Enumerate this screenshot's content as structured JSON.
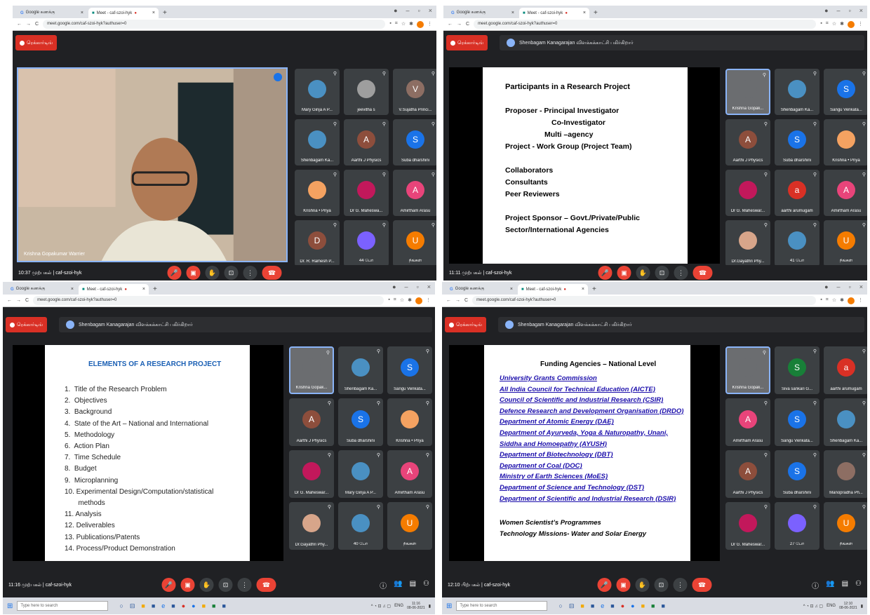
{
  "browser": {
    "tab1": "Google கணக்கு",
    "tab2": "Meet - caf-szoi-hyk",
    "url": "meet.google.com/caf-szoi-hyk?authuser=0",
    "url_short": "meet.google.com/caf-szoi-hyk"
  },
  "meet": {
    "record_label": "ரெக்கார்டிங்",
    "presenting": "Shenbagam Kanagarajan விளக்கக்காட்சி பகிர்கிறார்",
    "meeting_code": "caf-szoi-hyk"
  },
  "q1": {
    "time": "10:37 முற்பகல்",
    "speaker": "Krishna Gopakumar Warrier",
    "tiles": [
      {
        "name": "Mary Girija A P...",
        "initial": "",
        "color": "#4a90c2"
      },
      {
        "name": "jeevitha s",
        "initial": "",
        "color": "#9e9e9e"
      },
      {
        "name": "V.Sujatha Princi...",
        "initial": "V",
        "color": "#8d6e63"
      },
      {
        "name": "Shenbagam Ka...",
        "initial": "",
        "color": "#4a90c2"
      },
      {
        "name": "Aarthi J Physics",
        "initial": "A",
        "color": "#8d4e3c"
      },
      {
        "name": "Suba dharshini",
        "initial": "S",
        "color": "#1a73e8"
      },
      {
        "name": "Krishna • Priya",
        "initial": "",
        "color": "#f4a261"
      },
      {
        "name": "Dr G. Maheswa...",
        "initial": "",
        "color": "#c2185b"
      },
      {
        "name": "Amirtham Arasu",
        "initial": "A",
        "color": "#e8447a"
      },
      {
        "name": "Dr. R. Ramesh P...",
        "initial": "D",
        "color": "#8d4e3c"
      },
      {
        "name": "44 பேர்",
        "initial": "",
        "color": "#7b61ff"
      },
      {
        "name": "நீங்கள்",
        "initial": "U",
        "color": "#f57c00"
      }
    ]
  },
  "q2": {
    "time": "11:11 முற்பகல்",
    "slide": [
      "Participants in a Research Project",
      "Proposer -  Principal Investigator",
      "Co-Investigator",
      "Multi –agency",
      "Project -     Work Group (Project Team)",
      "Collaborators",
      "Consultants",
      "Peer Reviewers",
      "Project Sponsor – Govt./Private/Public",
      "Sector/International Agencies"
    ],
    "tiles": [
      {
        "name": "Krishna Gopak...",
        "initial": "",
        "color": "#6b6d70"
      },
      {
        "name": "Shenbagam Ka...",
        "initial": "",
        "color": "#4a90c2"
      },
      {
        "name": "Sangu Venkata...",
        "initial": "S",
        "color": "#1a73e8"
      },
      {
        "name": "Aarthi J Physics",
        "initial": "A",
        "color": "#8d4e3c"
      },
      {
        "name": "Suba dharshini",
        "initial": "S",
        "color": "#1a73e8"
      },
      {
        "name": "Krishna • Priya",
        "initial": "",
        "color": "#f4a261"
      },
      {
        "name": "Dr G. Maheswar...",
        "initial": "",
        "color": "#c2185b"
      },
      {
        "name": "aarthi arumugam",
        "initial": "a",
        "color": "#d93025"
      },
      {
        "name": "Amirtham Arasu",
        "initial": "A",
        "color": "#e8447a"
      },
      {
        "name": "Dr.Gayathri Phy...",
        "initial": "",
        "color": "#d7a58a"
      },
      {
        "name": "41 பேர்",
        "initial": "",
        "color": "#4a90c2"
      },
      {
        "name": "நீங்கள்",
        "initial": "U",
        "color": "#f57c00"
      }
    ]
  },
  "q3": {
    "time": "11:16 முற்பகல்",
    "slide_title": "ELEMENTS OF A RESEARCH PROJECT",
    "slide_items": [
      "1.  Title of the Research Problem",
      "2.  Objectives",
      "3.  Background",
      "4.  State of the Art – National and International",
      "5.  Methodology",
      "6.  Action Plan",
      "7.  Time Schedule",
      "8.  Budget",
      "9.  Microplanning",
      "10. Experimental Design/Computation/statistical",
      "       methods",
      "11. Analysis",
      "12. Deliverables",
      "13. Publications/Patents",
      "14. Process/Product Demonstration"
    ],
    "tiles": [
      {
        "name": "Krishna Gopak...",
        "initial": "",
        "color": "#6b6d70"
      },
      {
        "name": "Shenbagam Ka...",
        "initial": "",
        "color": "#4a90c2"
      },
      {
        "name": "Sangu Venkata...",
        "initial": "S",
        "color": "#1a73e8"
      },
      {
        "name": "Aarthi J Physics",
        "initial": "A",
        "color": "#8d4e3c"
      },
      {
        "name": "Suba dharshini",
        "initial": "S",
        "color": "#1a73e8"
      },
      {
        "name": "Krishna • Priya",
        "initial": "",
        "color": "#f4a261"
      },
      {
        "name": "Dr G. Maheswar...",
        "initial": "",
        "color": "#c2185b"
      },
      {
        "name": "Mary Girija A P...",
        "initial": "",
        "color": "#4a90c2"
      },
      {
        "name": "Amirtham Arasu",
        "initial": "A",
        "color": "#e8447a"
      },
      {
        "name": "Dr.Gayathri Phy...",
        "initial": "",
        "color": "#d7a58a"
      },
      {
        "name": "40 பேர்",
        "initial": "",
        "color": "#4a90c2"
      },
      {
        "name": "நீங்கள்",
        "initial": "U",
        "color": "#f57c00"
      }
    ],
    "date": "08-06-2021",
    "clock": "11:16"
  },
  "q4": {
    "time": "12:10 பிற்பகல்",
    "slide_title": "Funding Agencies – National Level",
    "links": [
      "University Grants Commission",
      "All India Council for Technical Education (AICTE)",
      "Council of Scientific and Industrial Research (CSIR)",
      "Defence Research and Development Organisation (DRDO)",
      "Department of Atomic Energy (DAE)",
      "Department of Ayurveda, Yoga & Naturopathy, Unani,",
      "Siddha and Homoepathy (AYUSH)",
      "Department of Biotechnology (DBT)",
      "Department of Coal (DOC)",
      "Ministry of Earth Sciences (MoES)",
      "Department of Science and Technology (DST)",
      "Department of Scientific and Industrial Research (DSIR)"
    ],
    "extra": [
      "Women Scientist’s Programmes",
      "Technology Missions- Water and Solar Energy"
    ],
    "tiles": [
      {
        "name": "Krishna Gopak...",
        "initial": "",
        "color": "#6b6d70"
      },
      {
        "name": "Siva sankari G...",
        "initial": "S",
        "color": "#188038"
      },
      {
        "name": "aarthi arumugam",
        "initial": "a",
        "color": "#d93025"
      },
      {
        "name": "Amirtham Arasu",
        "initial": "A",
        "color": "#e8447a"
      },
      {
        "name": "Sangu Venkata...",
        "initial": "S",
        "color": "#1a73e8"
      },
      {
        "name": "Shenbagam Ka...",
        "initial": "",
        "color": "#4a90c2"
      },
      {
        "name": "Aarthi J Physics",
        "initial": "A",
        "color": "#8d4e3c"
      },
      {
        "name": "Suba dharshini",
        "initial": "S",
        "color": "#1a73e8"
      },
      {
        "name": "Manopradha Ph...",
        "initial": "",
        "color": "#8d6e63"
      },
      {
        "name": "Dr G. Maheswar...",
        "initial": "",
        "color": "#c2185b"
      },
      {
        "name": "27 பேர்",
        "initial": "",
        "color": "#7b61ff"
      },
      {
        "name": "நீங்கள்",
        "initial": "U",
        "color": "#f57c00"
      }
    ],
    "date": "08-06-2021",
    "clock": "12:10"
  },
  "taskbar": {
    "search_placeholder": "Type here to search",
    "lang": "ENG"
  }
}
